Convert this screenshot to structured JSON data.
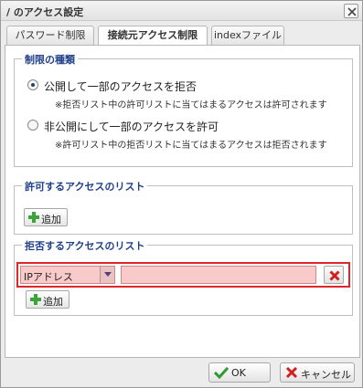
{
  "window": {
    "title": "/ のアクセス設定"
  },
  "tabs": [
    {
      "label": "パスワード制限",
      "active": false
    },
    {
      "label": "接続元アクセス制限",
      "active": true
    },
    {
      "label": "indexファイル",
      "active": false
    }
  ],
  "restriction_type": {
    "legend": "制限の種類",
    "options": [
      {
        "label": "公開して一部のアクセスを拒否",
        "note": "※拒否リスト中の許可リストに当てはまるアクセスは許可されます",
        "checked": true
      },
      {
        "label": "非公開にして一部のアクセスを許可",
        "note": "※許可リスト中の拒否リストに当てはまるアクセスは拒否されます",
        "checked": false
      }
    ]
  },
  "allow_list": {
    "legend": "許可するアクセスのリスト",
    "add_label": "追加",
    "entries": []
  },
  "deny_list": {
    "legend": "拒否するアクセスのリスト",
    "add_label": "追加",
    "entries": [
      {
        "type": "IPアドレス",
        "value": ""
      }
    ]
  },
  "footer": {
    "ok_label": "OK",
    "cancel_label": "キャンセル"
  },
  "colors": {
    "accent_blue": "#1f3f8a",
    "error_red": "#e0262b",
    "error_fill": "#f9caca",
    "add_green": "#3aa53a"
  }
}
